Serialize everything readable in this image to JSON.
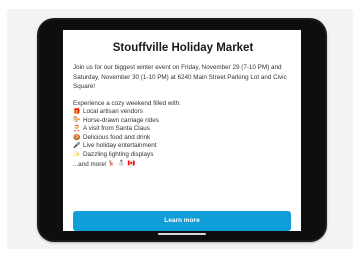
{
  "event": {
    "title": "Stouffville Holiday Market",
    "intro": "Join us for our biggest winter event on Friday, November 29 (7-10 PM) and Saturday, November 30 (1-10 PM) at 6240 Main Street Parking Lot and Civic Square!",
    "lead": "Experience a cozy weekend filled with:",
    "features": [
      {
        "icon": "gift-icon",
        "glyph": "🎁",
        "label": "Local artisan vendors"
      },
      {
        "icon": "horse-icon",
        "glyph": "🐎",
        "label": "Horse-drawn carriage rides"
      },
      {
        "icon": "santa-icon",
        "glyph": "🎅",
        "label": "A visit from Santa Claus"
      },
      {
        "icon": "cookie-icon",
        "glyph": "🍪",
        "label": "Delicious food and drink"
      },
      {
        "icon": "microphone-icon",
        "glyph": "🎤",
        "label": "Live holiday entertainment"
      },
      {
        "icon": "sparkles-icon",
        "glyph": "✨",
        "label": "Dazzling lighting displays"
      }
    ],
    "more_text": "...and more!",
    "more_icons": [
      {
        "icon": "deer-icon",
        "glyph": "🦌"
      },
      {
        "icon": "snowman-icon",
        "glyph": "⛄"
      },
      {
        "icon": "canada-flag-icon",
        "glyph": "🇨🇦"
      }
    ]
  },
  "cta": {
    "label": "Learn more",
    "color": "#0f9ed8"
  }
}
